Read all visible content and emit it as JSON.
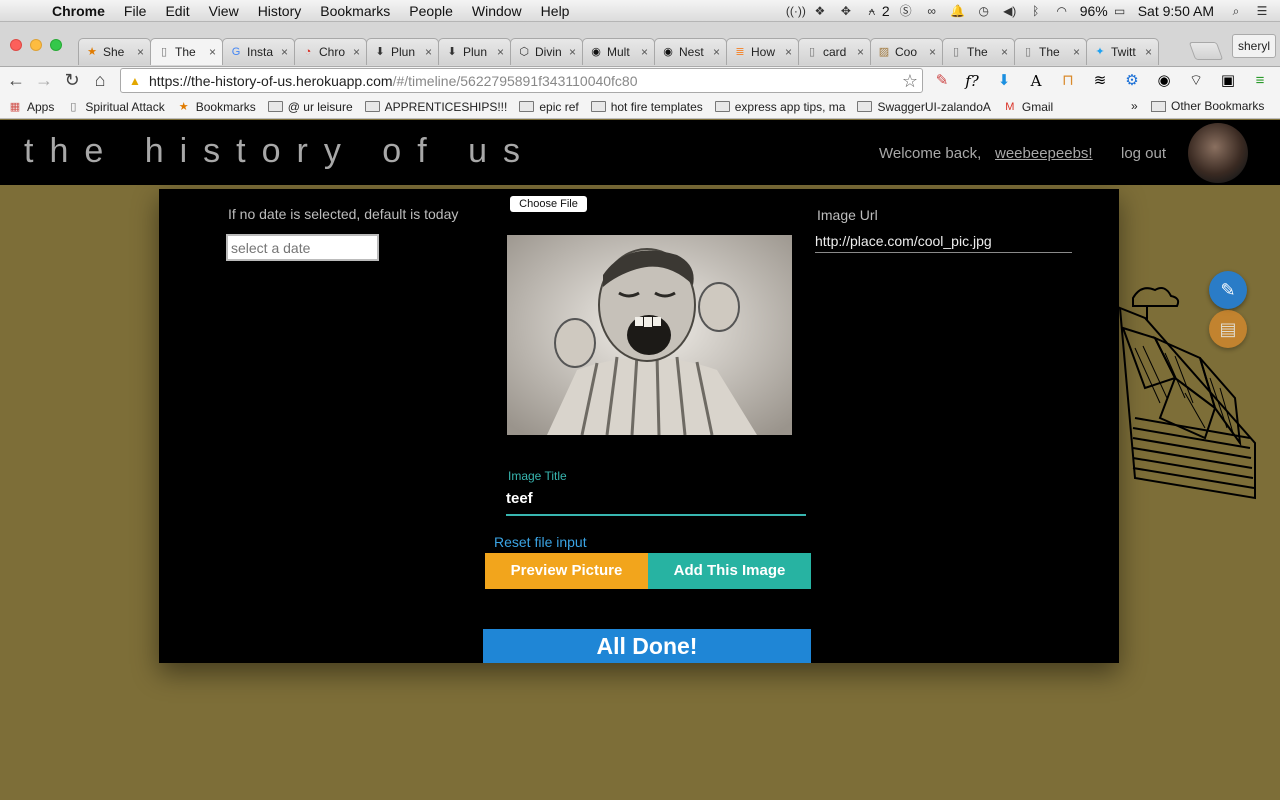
{
  "menubar": {
    "items": [
      "Chrome",
      "File",
      "Edit",
      "View",
      "History",
      "Bookmarks",
      "People",
      "Window",
      "Help"
    ],
    "adobe_count": "2",
    "battery": "96%",
    "clock": "Sat 9:50 AM"
  },
  "tabs": [
    {
      "title": "She",
      "icon": "star-icon",
      "active": false
    },
    {
      "title": "The",
      "icon": "page-icon",
      "active": true
    },
    {
      "title": "Insta",
      "icon": "google-icon",
      "active": false
    },
    {
      "title": "Chro",
      "icon": "chrome-icon",
      "active": false
    },
    {
      "title": "Plun",
      "icon": "download-icon",
      "active": false
    },
    {
      "title": "Plun",
      "icon": "download-icon",
      "active": false
    },
    {
      "title": "Divin",
      "icon": "cube-icon",
      "active": false
    },
    {
      "title": "Mult",
      "icon": "github-icon",
      "active": false
    },
    {
      "title": "Nest",
      "icon": "github-icon",
      "active": false
    },
    {
      "title": "How",
      "icon": "stackoverflow-icon",
      "active": false
    },
    {
      "title": "card",
      "icon": "page-icon",
      "active": false
    },
    {
      "title": "Coo",
      "icon": "image-icon",
      "active": false
    },
    {
      "title": "The",
      "icon": "page-icon",
      "active": false
    },
    {
      "title": "The",
      "icon": "page-icon",
      "active": false
    },
    {
      "title": "Twitt",
      "icon": "twitter-icon",
      "active": false
    }
  ],
  "profile_name": "sheryl",
  "address": {
    "host": "https://the-history-of-us.herokuapp.com",
    "path": "/#/timeline/5622795891f343110040fc80"
  },
  "bookmarks": [
    {
      "label": "Apps",
      "icon": "apps-grid-icon"
    },
    {
      "label": "Spiritual Attack",
      "icon": "page-icon"
    },
    {
      "label": "Bookmarks",
      "icon": "star-icon"
    },
    {
      "label": "@ ur leisure",
      "icon": "folder-icon"
    },
    {
      "label": "APPRENTICESHIPS!!!",
      "icon": "folder-icon"
    },
    {
      "label": "epic ref",
      "icon": "folder-icon"
    },
    {
      "label": "hot fire templates",
      "icon": "folder-icon"
    },
    {
      "label": "express app tips, ma",
      "icon": "folder-icon"
    },
    {
      "label": "SwaggerUI-zalandoA",
      "icon": "folder-icon"
    },
    {
      "label": "Gmail",
      "icon": "gmail-icon"
    }
  ],
  "bookmarks_overflow": "»",
  "bookmarks_other": "Other Bookmarks",
  "site": {
    "logo": "the history of us",
    "welcome": "Welcome back,",
    "username": "weebeepeebs!",
    "logout": "log out"
  },
  "form": {
    "date_hint": "If no date is selected, default is today",
    "date_placeholder": "select a date",
    "choose_file": "Choose File",
    "image_url_label": "Image Url",
    "image_url_value": "http://place.com/cool_pic.jpg",
    "image_title_label": "Image Title",
    "image_title_value": "teef",
    "reset_link": "Reset file input",
    "preview_button": "Preview Picture",
    "add_button": "Add This Image",
    "done_button": "All Done!"
  },
  "colors": {
    "page_bg": "#7d6e38",
    "preview_btn": "#f2a51c",
    "add_btn": "#27b3a2",
    "done_btn": "#1f86d6",
    "accent_teal": "#38b6b0",
    "link_blue": "#3aa3e3"
  }
}
